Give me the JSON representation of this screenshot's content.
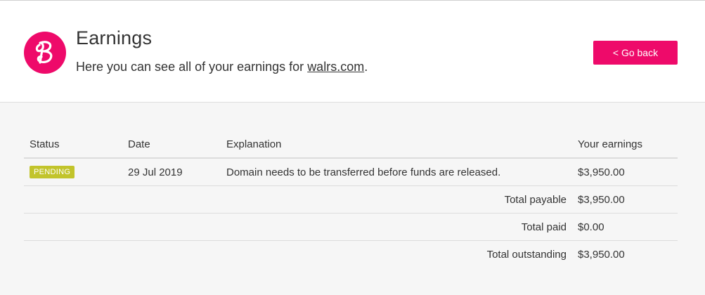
{
  "header": {
    "title": "Earnings",
    "subtitle_prefix": "Here you can see all of your earnings for ",
    "domain": "walrs.com",
    "subtitle_suffix": ".",
    "go_back_label": "< Go back",
    "logo_icon": "bodis-logo-icon",
    "brand_color": "#ee0a6a"
  },
  "table": {
    "columns": [
      "Status",
      "Date",
      "Explanation",
      "Your earnings"
    ],
    "rows": [
      {
        "status": "PENDING",
        "date": "29 Jul 2019",
        "explanation": "Domain needs to be transferred before funds are released.",
        "earnings": "$3,950.00"
      }
    ],
    "totals": [
      {
        "label": "Total payable",
        "value": "$3,950.00"
      },
      {
        "label": "Total paid",
        "value": "$0.00"
      },
      {
        "label": "Total outstanding",
        "value": "$3,950.00"
      }
    ],
    "status_color": "#c2c42b"
  }
}
